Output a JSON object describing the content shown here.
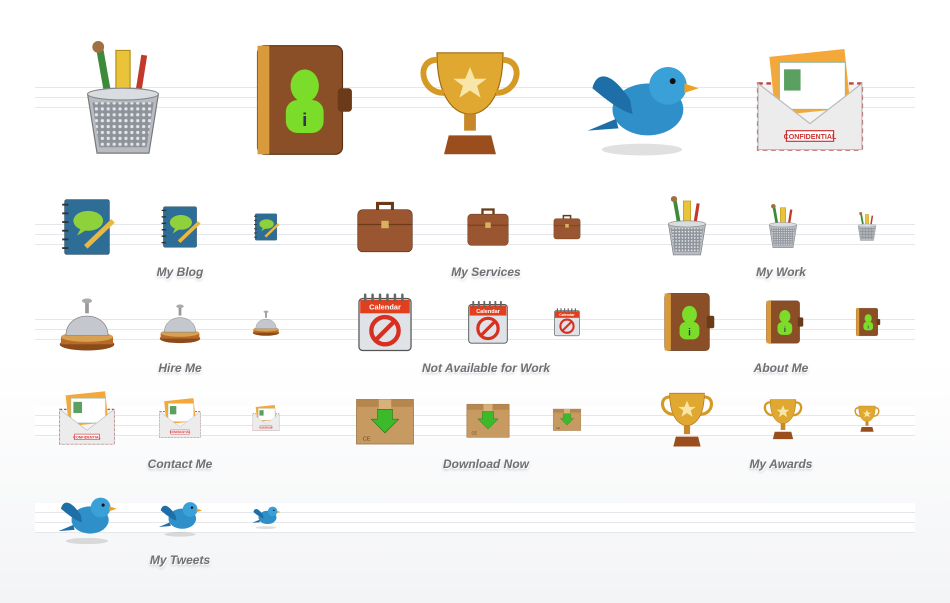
{
  "hero_icons": [
    {
      "name": "pencil-cup-icon",
      "type": "cup"
    },
    {
      "name": "organizer-icon",
      "type": "organizer"
    },
    {
      "name": "trophy-icon",
      "type": "trophy"
    },
    {
      "name": "bird-icon",
      "type": "bird"
    },
    {
      "name": "envelope-icon",
      "type": "envelope"
    }
  ],
  "groups": [
    {
      "label": "My Blog",
      "type": "blog",
      "icon": "blog-notebook-icon"
    },
    {
      "label": "My Services",
      "type": "briefcase",
      "icon": "briefcase-icon"
    },
    {
      "label": "My Work",
      "type": "cup",
      "icon": "pencil-cup-icon"
    },
    {
      "label": "Hire Me",
      "type": "bell",
      "icon": "service-bell-icon"
    },
    {
      "label": "Not Available for Work",
      "type": "calendar",
      "icon": "calendar-unavailable-icon"
    },
    {
      "label": "About Me",
      "type": "organizer",
      "icon": "organizer-icon"
    },
    {
      "label": "Contact Me",
      "type": "envelope",
      "icon": "envelope-icon"
    },
    {
      "label": "Download Now",
      "type": "box",
      "icon": "download-box-icon"
    },
    {
      "label": "My Awards",
      "type": "trophy",
      "icon": "trophy-icon"
    },
    {
      "label": "My Tweets",
      "type": "bird",
      "icon": "bird-icon"
    }
  ],
  "icon_text": {
    "calendar": "Calendar",
    "envelope": "CONFIDENTIAL",
    "box": "CE"
  },
  "colors": {
    "label": "#6d7075",
    "guide": "#e6e7ea"
  }
}
